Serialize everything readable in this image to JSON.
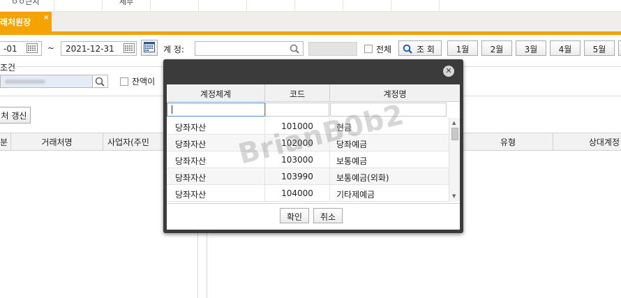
{
  "top_strip": {
    "left_text": "ㅇㅇ근시",
    "mid_text": "세무"
  },
  "tab": {
    "label": "래처원장",
    "close": "×"
  },
  "filter": {
    "date_from": "-01",
    "tilde": "~",
    "date_to": "2021-12-31",
    "account_label": "계 정:",
    "all_label": "전체",
    "search_button": "조 회",
    "months": [
      "1월",
      "2월",
      "3월",
      "4월",
      "5월"
    ]
  },
  "conditions": {
    "legend": "조건",
    "balance_label": "잔액이 ",
    "refresh_button": "처 갱신"
  },
  "grid": {
    "headers": [
      "분",
      "거래처명",
      "사업자(주민",
      "유형",
      "상대계정"
    ]
  },
  "modal": {
    "columns": [
      "계정체계",
      "코드",
      "계정명"
    ],
    "rows": [
      {
        "system": "당좌자산",
        "code": "101000",
        "name": "현금"
      },
      {
        "system": "당좌자산",
        "code": "102000",
        "name": "당좌예금"
      },
      {
        "system": "당좌자산",
        "code": "103000",
        "name": "보통예금"
      },
      {
        "system": "당좌자산",
        "code": "103990",
        "name": "보통예금(외화)"
      },
      {
        "system": "당좌자산",
        "code": "104000",
        "name": "기타제예금"
      }
    ],
    "ok_button": "확인",
    "cancel_button": "취소"
  },
  "watermark": "BrianB0b2"
}
